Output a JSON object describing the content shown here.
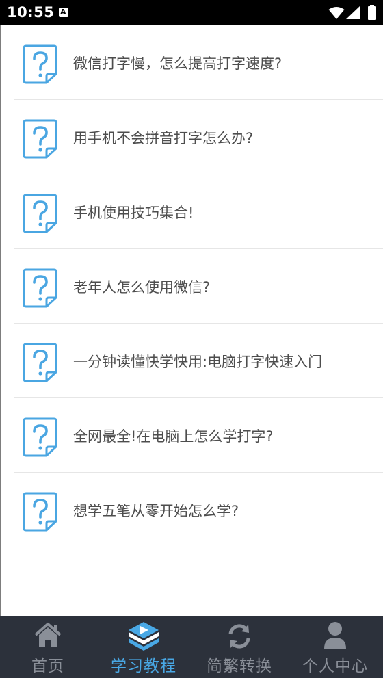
{
  "status_bar": {
    "time": "10:55",
    "notification_icon": "a-box-icon",
    "wifi_icon": "wifi-icon",
    "signal_icon": "signal-icon",
    "battery_icon": "battery-icon"
  },
  "tutorials": [
    {
      "title": "微信打字慢，怎么提高打字速度?",
      "icon": "question-doc-icon"
    },
    {
      "title": "用手机不会拼音打字怎么办?",
      "icon": "question-doc-icon"
    },
    {
      "title": "手机使用技巧集合!",
      "icon": "question-doc-icon"
    },
    {
      "title": "老年人怎么使用微信?",
      "icon": "question-doc-icon"
    },
    {
      "title": "一分钟读懂快学快用:电脑打字快速入门",
      "icon": "question-doc-icon"
    },
    {
      "title": "全网最全!在电脑上怎么学打字?",
      "icon": "question-doc-icon"
    },
    {
      "title": "想学五笔从零开始怎么学?",
      "icon": "question-doc-icon"
    }
  ],
  "tabbar": {
    "tabs": [
      {
        "label": "首页",
        "icon": "home-icon",
        "active": false
      },
      {
        "label": "学习教程",
        "icon": "tutorial-icon",
        "active": true
      },
      {
        "label": "简繁转换",
        "icon": "refresh-icon",
        "active": false
      },
      {
        "label": "个人中心",
        "icon": "user-icon",
        "active": false
      }
    ]
  },
  "colors": {
    "accent": "#49a8e5",
    "tabbar_bg": "#2c313b",
    "tab_inactive": "#8a8f98",
    "text": "#4d4d4d"
  }
}
